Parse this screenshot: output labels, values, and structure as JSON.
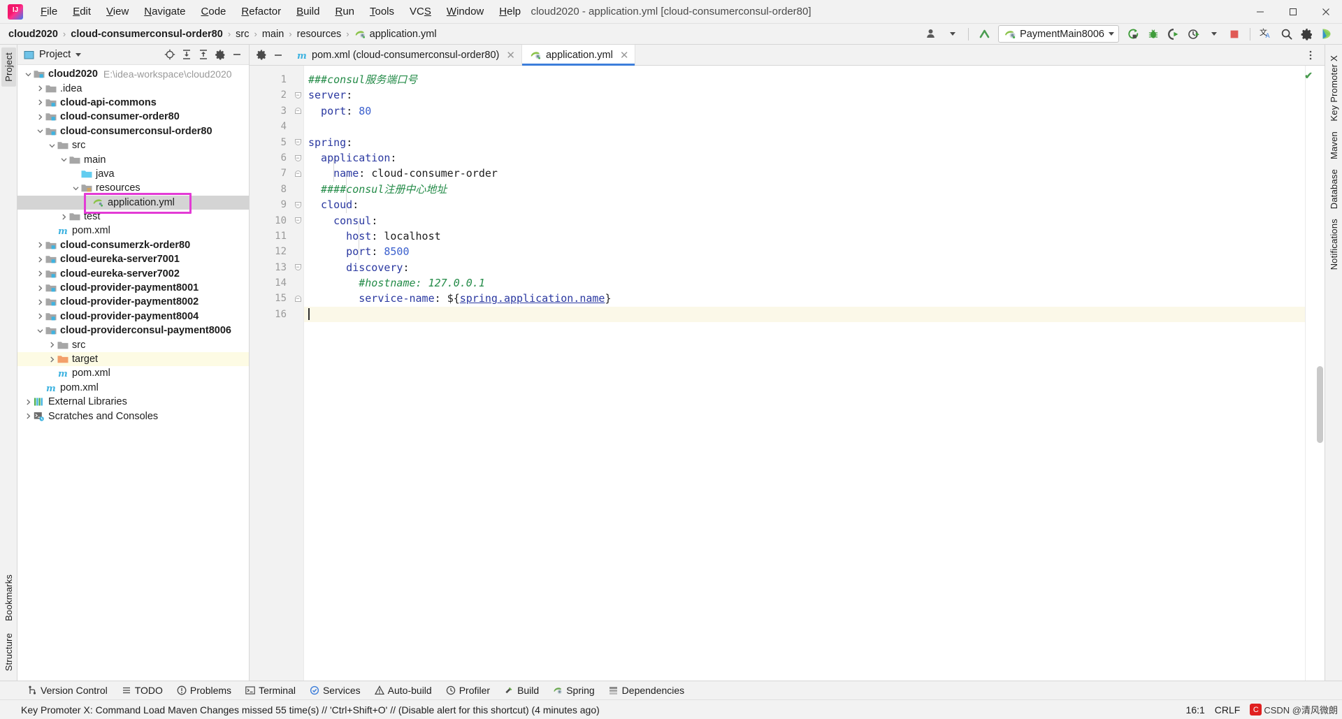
{
  "window": {
    "title": "cloud2020 - application.yml [cloud-consumerconsul-order80]",
    "minimize": "─",
    "maximize": "❐",
    "close": "✕"
  },
  "menubar": {
    "items": [
      {
        "label": "File",
        "mnemonic": "F"
      },
      {
        "label": "Edit",
        "mnemonic": "E"
      },
      {
        "label": "View",
        "mnemonic": "V"
      },
      {
        "label": "Navigate",
        "mnemonic": "N"
      },
      {
        "label": "Code",
        "mnemonic": "C"
      },
      {
        "label": "Refactor",
        "mnemonic": "R"
      },
      {
        "label": "Build",
        "mnemonic": "B"
      },
      {
        "label": "Run",
        "mnemonic": "R"
      },
      {
        "label": "Tools",
        "mnemonic": "T"
      },
      {
        "label": "VCS",
        "mnemonic": "S"
      },
      {
        "label": "Window",
        "mnemonic": "W"
      },
      {
        "label": "Help",
        "mnemonic": "H"
      }
    ]
  },
  "breadcrumb": {
    "separator": "›",
    "items": [
      {
        "label": "cloud2020",
        "bold": true,
        "icon": ""
      },
      {
        "label": "cloud-consumerconsul-order80",
        "bold": true,
        "icon": ""
      },
      {
        "label": "src",
        "bold": false,
        "icon": ""
      },
      {
        "label": "main",
        "bold": false,
        "icon": ""
      },
      {
        "label": "resources",
        "bold": false,
        "icon": ""
      },
      {
        "label": "application.yml",
        "bold": false,
        "icon": "spring-yaml-icon"
      }
    ]
  },
  "toolbar": {
    "user_icon": "user-avatar-icon",
    "updates_icon": "update-arrow-icon",
    "run_config": {
      "name": "PaymentMain8006",
      "icon": "spring-boot-icon",
      "dropdown": "▾"
    },
    "buttons": [
      {
        "name": "run-button",
        "icon": "run-icon",
        "color": "#3f9c3a"
      },
      {
        "name": "debug-button",
        "icon": "debug-icon",
        "color": "#3f9c3a"
      },
      {
        "name": "run-with-coverage-button",
        "icon": "coverage-icon",
        "color": "#4a4a4a"
      },
      {
        "name": "profiler-button",
        "icon": "profiler-icon",
        "color": "#4a4a4a"
      },
      {
        "name": "stop-button",
        "icon": "stop-icon",
        "color": "#e05a55"
      },
      {
        "name": "translate-button",
        "icon": "translate-icon",
        "color": "#3b3b3b"
      },
      {
        "name": "search-everywhere-button",
        "icon": "search-icon",
        "color": "#3b3b3b"
      },
      {
        "name": "settings-button",
        "icon": "gear-icon",
        "color": "#3b3b3b"
      },
      {
        "name": "ide-helper-button",
        "icon": "colored-orb-icon",
        "color": "#2fb5d0"
      }
    ]
  },
  "left_strip": {
    "top": [
      {
        "label": "Project",
        "selected": true
      }
    ],
    "bottom": [
      {
        "label": "Bookmarks",
        "selected": false
      },
      {
        "label": "Structure",
        "selected": false
      }
    ]
  },
  "right_strip": {
    "items": [
      {
        "label": "Key Promoter X"
      },
      {
        "label": "Maven"
      },
      {
        "label": "Database"
      },
      {
        "label": "Notifications"
      }
    ]
  },
  "project_panel": {
    "title": "Project",
    "title_icon": "project-view-icon",
    "dropdown": "▾",
    "actions": [
      {
        "name": "scroll-from-source-button",
        "icon": "target-icon"
      },
      {
        "name": "expand-all-button",
        "icon": "expand-all-icon"
      },
      {
        "name": "collapse-all-button",
        "icon": "collapse-all-icon"
      },
      {
        "name": "panel-settings-button",
        "icon": "gear-icon"
      },
      {
        "name": "hide-panel-button",
        "icon": "minimize-icon"
      }
    ],
    "tree": [
      {
        "depth": 0,
        "label": "cloud2020",
        "path": "E:\\idea-workspace\\cloud2020",
        "icon": "maven-module-icon",
        "twist": "open",
        "bold": true
      },
      {
        "depth": 1,
        "label": ".idea",
        "icon": "folder-icon",
        "twist": "closed",
        "bold": false
      },
      {
        "depth": 1,
        "label": "cloud-api-commons",
        "icon": "maven-module-icon",
        "twist": "closed",
        "bold": true
      },
      {
        "depth": 1,
        "label": "cloud-consumer-order80",
        "icon": "maven-module-icon",
        "twist": "closed",
        "bold": true
      },
      {
        "depth": 1,
        "label": "cloud-consumerconsul-order80",
        "icon": "maven-module-icon",
        "twist": "open",
        "bold": true
      },
      {
        "depth": 2,
        "label": "src",
        "icon": "folder-icon",
        "twist": "open",
        "bold": false
      },
      {
        "depth": 3,
        "label": "main",
        "icon": "folder-icon",
        "twist": "open",
        "bold": false
      },
      {
        "depth": 4,
        "label": "java",
        "icon": "source-root-icon",
        "twist": "none",
        "bold": false
      },
      {
        "depth": 4,
        "label": "resources",
        "icon": "resource-root-icon",
        "twist": "open",
        "bold": false
      },
      {
        "depth": 5,
        "label": "application.yml",
        "icon": "spring-yaml-icon",
        "twist": "none",
        "bold": false,
        "selected": true,
        "annotated": true
      },
      {
        "depth": 3,
        "label": "test",
        "icon": "folder-icon",
        "twist": "closed",
        "bold": false
      },
      {
        "depth": 2,
        "label": "pom.xml",
        "icon": "maven-pom-icon",
        "twist": "none",
        "bold": false
      },
      {
        "depth": 1,
        "label": "cloud-consumerzk-order80",
        "icon": "maven-module-icon",
        "twist": "closed",
        "bold": true
      },
      {
        "depth": 1,
        "label": "cloud-eureka-server7001",
        "icon": "maven-module-icon",
        "twist": "closed",
        "bold": true
      },
      {
        "depth": 1,
        "label": "cloud-eureka-server7002",
        "icon": "maven-module-icon",
        "twist": "closed",
        "bold": true
      },
      {
        "depth": 1,
        "label": "cloud-provider-payment8001",
        "icon": "maven-module-icon",
        "twist": "closed",
        "bold": true
      },
      {
        "depth": 1,
        "label": "cloud-provider-payment8002",
        "icon": "maven-module-icon",
        "twist": "closed",
        "bold": true
      },
      {
        "depth": 1,
        "label": "cloud-provider-payment8004",
        "icon": "maven-module-icon",
        "twist": "closed",
        "bold": true
      },
      {
        "depth": 1,
        "label": "cloud-providerconsul-payment8006",
        "icon": "maven-module-icon",
        "twist": "open",
        "bold": true
      },
      {
        "depth": 2,
        "label": "src",
        "icon": "folder-icon",
        "twist": "closed",
        "bold": false
      },
      {
        "depth": 2,
        "label": "target",
        "icon": "excluded-folder-icon",
        "twist": "closed",
        "bold": false,
        "excluded": true
      },
      {
        "depth": 2,
        "label": "pom.xml",
        "icon": "maven-pom-icon",
        "twist": "none",
        "bold": false
      },
      {
        "depth": 1,
        "label": "pom.xml",
        "icon": "maven-pom-icon",
        "twist": "none",
        "bold": false
      },
      {
        "depth": 0,
        "label": "External Libraries",
        "icon": "libraries-icon",
        "twist": "closed",
        "bold": false
      },
      {
        "depth": 0,
        "label": "Scratches and Consoles",
        "icon": "scratches-icon",
        "twist": "closed",
        "bold": false
      }
    ]
  },
  "editor": {
    "tabs": [
      {
        "label": "pom.xml (cloud-consumerconsul-order80)",
        "icon": "maven-pom-icon",
        "active": false,
        "close": "✕"
      },
      {
        "label": "application.yml",
        "icon": "spring-yaml-icon",
        "active": true,
        "close": "✕"
      }
    ],
    "tabbar_actions": [
      {
        "name": "editor-settings-button",
        "icon": "gear-icon"
      },
      {
        "name": "hide-editor-button",
        "icon": "minimize-icon"
      },
      {
        "name": "more-options-button",
        "icon": "vertical-dots-icon"
      }
    ],
    "inspection_status": "✔",
    "filename": "application.yml",
    "lines": [
      {
        "n": 1,
        "fold": "none",
        "tokens": [
          {
            "t": "###consul服务端口号",
            "c": "comment",
            "indent": 0
          }
        ]
      },
      {
        "n": 2,
        "fold": "open",
        "tokens": [
          {
            "t": "server",
            "c": "key",
            "indent": 0
          },
          {
            "t": ":",
            "c": "punct"
          }
        ]
      },
      {
        "n": 3,
        "fold": "end",
        "tokens": [
          {
            "t": "port",
            "c": "key",
            "indent": 1
          },
          {
            "t": ": ",
            "c": "punct"
          },
          {
            "t": "80",
            "c": "num"
          }
        ]
      },
      {
        "n": 4,
        "fold": "none",
        "tokens": []
      },
      {
        "n": 5,
        "fold": "open",
        "tokens": [
          {
            "t": "spring",
            "c": "key",
            "indent": 0
          },
          {
            "t": ":",
            "c": "punct"
          }
        ]
      },
      {
        "n": 6,
        "fold": "open",
        "tokens": [
          {
            "t": "application",
            "c": "key",
            "indent": 1
          },
          {
            "t": ":",
            "c": "punct"
          }
        ]
      },
      {
        "n": 7,
        "fold": "end",
        "tokens": [
          {
            "t": "name",
            "c": "key",
            "indent": 2
          },
          {
            "t": ": ",
            "c": "punct"
          },
          {
            "t": "cloud-consumer-order",
            "c": "str"
          }
        ]
      },
      {
        "n": 8,
        "fold": "none",
        "tokens": [
          {
            "t": "####consul注册中心地址",
            "c": "comment",
            "indent": 1
          }
        ]
      },
      {
        "n": 9,
        "fold": "open",
        "tokens": [
          {
            "t": "cloud",
            "c": "key",
            "indent": 1
          },
          {
            "t": ":",
            "c": "punct"
          }
        ]
      },
      {
        "n": 10,
        "fold": "open",
        "tokens": [
          {
            "t": "consul",
            "c": "key",
            "indent": 2
          },
          {
            "t": ":",
            "c": "punct"
          }
        ]
      },
      {
        "n": 11,
        "fold": "none",
        "tokens": [
          {
            "t": "host",
            "c": "key",
            "indent": 3
          },
          {
            "t": ": ",
            "c": "punct"
          },
          {
            "t": "localhost",
            "c": "str"
          }
        ]
      },
      {
        "n": 12,
        "fold": "none",
        "tokens": [
          {
            "t": "port",
            "c": "key",
            "indent": 3
          },
          {
            "t": ": ",
            "c": "punct"
          },
          {
            "t": "8500",
            "c": "num"
          }
        ]
      },
      {
        "n": 13,
        "fold": "open",
        "tokens": [
          {
            "t": "discovery",
            "c": "key",
            "indent": 3
          },
          {
            "t": ":",
            "c": "punct"
          }
        ]
      },
      {
        "n": 14,
        "fold": "none",
        "tokens": [
          {
            "t": "#hostname: 127.0.0.1",
            "c": "comment",
            "indent": 4
          }
        ]
      },
      {
        "n": 15,
        "fold": "end",
        "tokens": [
          {
            "t": "service-name",
            "c": "key",
            "indent": 4
          },
          {
            "t": ": ",
            "c": "punct"
          },
          {
            "t": "${",
            "c": "punct"
          },
          {
            "t": "spring.application.name",
            "c": "var"
          },
          {
            "t": "}",
            "c": "punct"
          }
        ]
      },
      {
        "n": 16,
        "fold": "none",
        "caret": true,
        "tokens": []
      }
    ]
  },
  "bottom_toolwindows": [
    {
      "label": "Version Control",
      "icon": "branch-icon"
    },
    {
      "label": "TODO",
      "icon": "todo-icon"
    },
    {
      "label": "Problems",
      "icon": "problems-icon"
    },
    {
      "label": "Terminal",
      "icon": "terminal-icon"
    },
    {
      "label": "Services",
      "icon": "services-icon"
    },
    {
      "label": "Auto-build",
      "icon": "autobuild-icon"
    },
    {
      "label": "Profiler",
      "icon": "profiler-icon"
    },
    {
      "label": "Build",
      "icon": "build-icon"
    },
    {
      "label": "Spring",
      "icon": "spring-icon"
    },
    {
      "label": "Dependencies",
      "icon": "dependencies-icon"
    }
  ],
  "statusbar": {
    "message": "Key Promoter X: Command Load Maven Changes missed 55 time(s) // 'Ctrl+Shift+O' // (Disable alert for this shortcut) (4 minutes ago)",
    "caret_position": "16:1",
    "line_separator": "CRLF",
    "watermark": "CSDN @清风微朗"
  },
  "colors": {
    "accent": "#3d7eda",
    "annotation": "#e33bd5",
    "comment": "#248b48",
    "key": "#2a38a0",
    "number": "#3a5fcd",
    "selection": "#d4d4d4",
    "excluded_row": "#fdfbe4",
    "caret_line": "#fbf8e8"
  }
}
